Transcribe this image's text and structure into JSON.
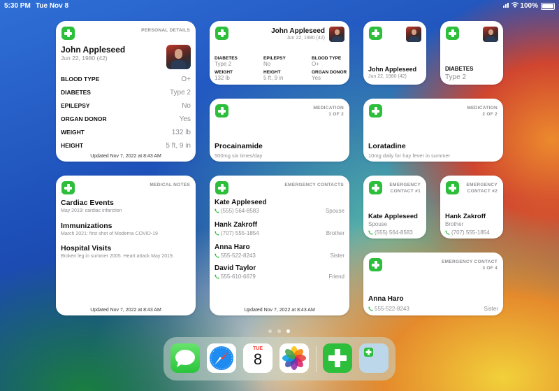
{
  "status": {
    "time": "5:30 PM",
    "date": "Tue Nov 8",
    "battery": "100%"
  },
  "colors": {
    "accent": "#2dbe3c",
    "label_gray": "#8e8e93"
  },
  "personal_details": {
    "tag": "PERSONAL DETAILS",
    "name": "John Appleseed",
    "dob": "Jun 22, 1980 (42)",
    "rows": [
      {
        "label": "BLOOD TYPE",
        "value": "O+"
      },
      {
        "label": "DIABETES",
        "value": "Type 2"
      },
      {
        "label": "EPILEPSY",
        "value": "No"
      },
      {
        "label": "ORGAN DONOR",
        "value": "Yes"
      },
      {
        "label": "WEIGHT",
        "value": "132 lb"
      },
      {
        "label": "HEIGHT",
        "value": "5 ft, 9 in"
      }
    ],
    "updated": "Updated Nov 7, 2022 at 8:43 AM"
  },
  "summary": {
    "name": "John Appleseed",
    "dob": "Jun 22, 1980 (42)",
    "cells": [
      {
        "label": "DIABETES",
        "value": "Type 2"
      },
      {
        "label": "EPILEPSY",
        "value": "No"
      },
      {
        "label": "BLOOD TYPE",
        "value": "O+"
      },
      {
        "label": "WEIGHT",
        "value": "132 lb"
      },
      {
        "label": "HEIGHT",
        "value": "5 ft, 9 in"
      },
      {
        "label": "ORGAN DONOR",
        "value": "Yes"
      }
    ]
  },
  "small_profile": {
    "name": "John Appleseed",
    "dob": "Jun 22, 1980 (42)"
  },
  "small_diabetes": {
    "label": "DIABETES",
    "value": "Type 2"
  },
  "medication1": {
    "tag1": "MEDICATION",
    "tag2": "1 OF 2",
    "name": "Procainamide",
    "detail": "500mg six times/day"
  },
  "medication2": {
    "tag1": "MEDICATION",
    "tag2": "2 OF 2",
    "name": "Loratadine",
    "detail": "10mg daily for hay fever in summer"
  },
  "medical_notes": {
    "tag": "MEDICAL NOTES",
    "notes": [
      {
        "title": "Cardiac Events",
        "detail": "May 2019: cardiac infarction"
      },
      {
        "title": "Immunizations",
        "detail": "March 2021: first shot of Moderna COVID-19"
      },
      {
        "title": "Hospital Visits",
        "detail": "Broken leg in summer 2005. Heart attack May 2019."
      }
    ],
    "updated": "Updated Nov 7, 2022 at 8:43 AM"
  },
  "emergency_contacts": {
    "tag": "EMERGENCY CONTACTS",
    "contacts": [
      {
        "name": "Kate Appleseed",
        "phone": "(555) 564-8583",
        "relation": "Spouse"
      },
      {
        "name": "Hank Zakroff",
        "phone": "(707) 555-1854",
        "relation": "Brother"
      },
      {
        "name": "Anna Haro",
        "phone": "555-522-8243",
        "relation": "Sister"
      },
      {
        "name": "David Taylor",
        "phone": "555-610-6679",
        "relation": "Friend"
      }
    ],
    "updated": "Updated Nov 7, 2022 at 8:43 AM"
  },
  "contact1": {
    "tag1": "EMERGENCY",
    "tag2": "CONTACT #1",
    "name": "Kate Appleseed",
    "relation": "Spouse",
    "phone": "(555) 564-8583"
  },
  "contact2": {
    "tag1": "EMERGENCY",
    "tag2": "CONTACT #2",
    "name": "Hank Zakroff",
    "relation": "Brother",
    "phone": "(707) 555-1854"
  },
  "contact3": {
    "tag1": "EMERGENCY CONTACT",
    "tag2": "3 OF 4",
    "name": "Anna Haro",
    "phone": "555-522-8243",
    "relation": "Sister"
  },
  "dock": {
    "calendar_day": "TUE",
    "calendar_date": "8",
    "apps": [
      "messages-icon",
      "safari-icon",
      "calendar-icon",
      "photos-icon",
      "medical-id-icon",
      "widget-app-icon"
    ]
  }
}
